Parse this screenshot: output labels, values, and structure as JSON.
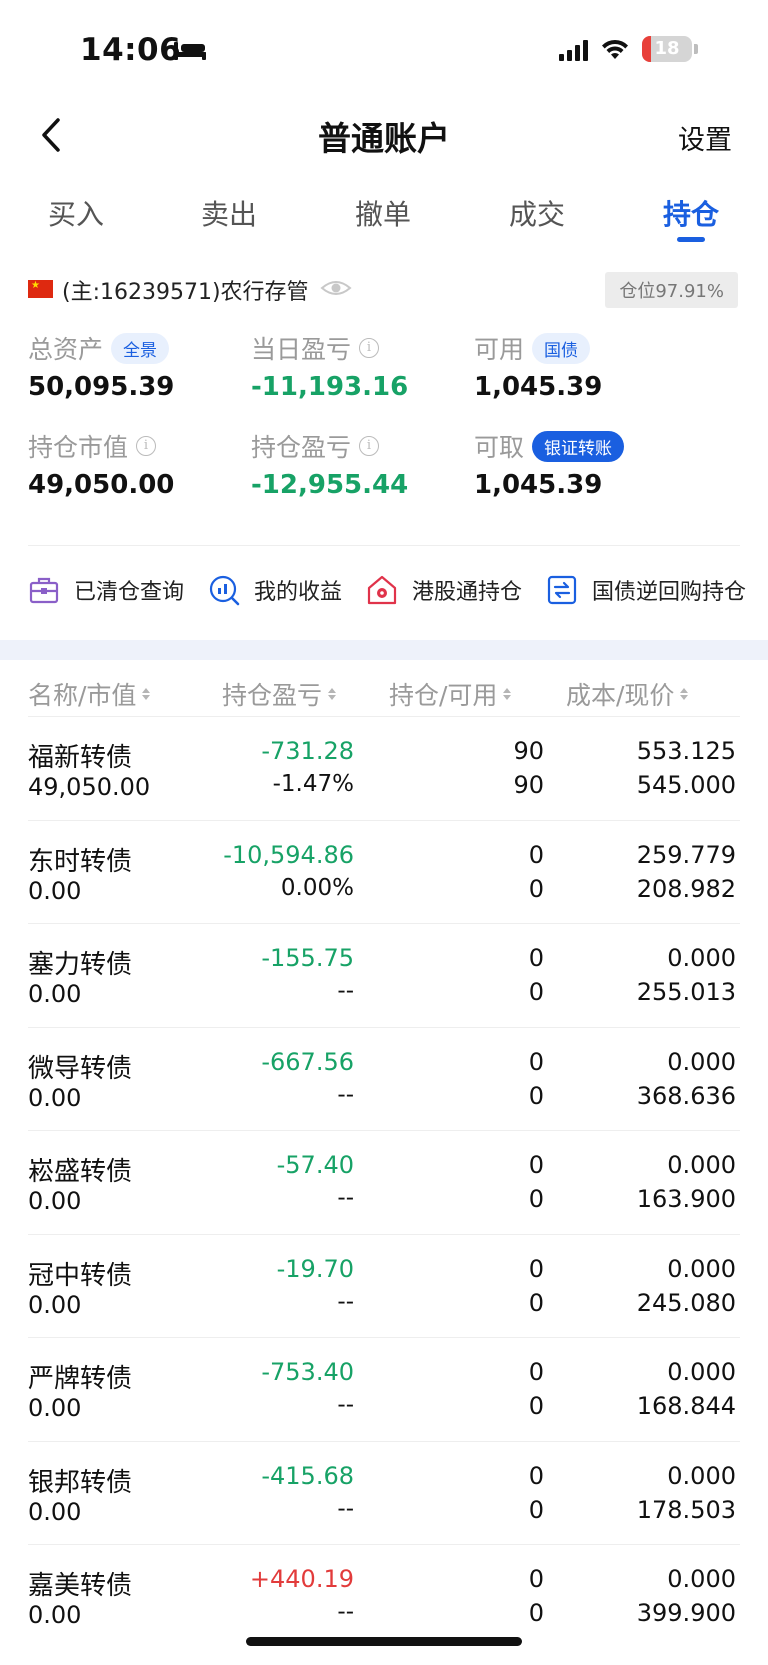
{
  "status_bar": {
    "time": "14:06",
    "battery": "18"
  },
  "nav": {
    "title": "普通账户",
    "settings_label": "设置"
  },
  "tabs": [
    {
      "label": "买入",
      "active": false
    },
    {
      "label": "卖出",
      "active": false
    },
    {
      "label": "撤单",
      "active": false
    },
    {
      "label": "成交",
      "active": false
    },
    {
      "label": "持仓",
      "active": true
    }
  ],
  "account": {
    "text": "(主:16239571)农行存管",
    "position_ratio": "仓位97.91%"
  },
  "summary": {
    "total_assets": {
      "label": "总资产",
      "badge": "全景",
      "value": "50,095.39"
    },
    "daily_pnl": {
      "label": "当日盈亏",
      "value": "-11,193.16"
    },
    "available": {
      "label": "可用",
      "badge": "国债",
      "value": "1,045.39"
    },
    "market_value": {
      "label": "持仓市值",
      "value": "49,050.00"
    },
    "position_pnl": {
      "label": "持仓盈亏",
      "value": "-12,955.44"
    },
    "withdrawable": {
      "label": "可取",
      "badge": "银证转账",
      "value": "1,045.39"
    }
  },
  "shortcuts": [
    {
      "label": "已清仓查询",
      "icon": "briefcase-icon"
    },
    {
      "label": "我的收益",
      "icon": "chart-magnifier-icon"
    },
    {
      "label": "港股通持仓",
      "icon": "hk-house-icon"
    },
    {
      "label": "国债逆回购持仓",
      "icon": "exchange-icon"
    }
  ],
  "table": {
    "headers": [
      "名称/市值",
      "持仓盈亏",
      "持仓/可用",
      "成本/现价"
    ],
    "rows": [
      {
        "name": "福新转债",
        "market_value": "49,050.00",
        "pnl": "-731.28",
        "pnl_pct": "-1.47%",
        "qty": "90",
        "avail": "90",
        "cost": "553.125",
        "price": "545.000",
        "pnl_color": "green"
      },
      {
        "name": "东时转债",
        "market_value": "0.00",
        "pnl": "-10,594.86",
        "pnl_pct": "0.00%",
        "qty": "0",
        "avail": "0",
        "cost": "259.779",
        "price": "208.982",
        "pnl_color": "green"
      },
      {
        "name": "塞力转债",
        "market_value": "0.00",
        "pnl": "-155.75",
        "pnl_pct": "--",
        "qty": "0",
        "avail": "0",
        "cost": "0.000",
        "price": "255.013",
        "pnl_color": "green"
      },
      {
        "name": "微导转债",
        "market_value": "0.00",
        "pnl": "-667.56",
        "pnl_pct": "--",
        "qty": "0",
        "avail": "0",
        "cost": "0.000",
        "price": "368.636",
        "pnl_color": "green"
      },
      {
        "name": "崧盛转债",
        "market_value": "0.00",
        "pnl": "-57.40",
        "pnl_pct": "--",
        "qty": "0",
        "avail": "0",
        "cost": "0.000",
        "price": "163.900",
        "pnl_color": "green"
      },
      {
        "name": "冠中转债",
        "market_value": "0.00",
        "pnl": "-19.70",
        "pnl_pct": "--",
        "qty": "0",
        "avail": "0",
        "cost": "0.000",
        "price": "245.080",
        "pnl_color": "green"
      },
      {
        "name": "严牌转债",
        "market_value": "0.00",
        "pnl": "-753.40",
        "pnl_pct": "--",
        "qty": "0",
        "avail": "0",
        "cost": "0.000",
        "price": "168.844",
        "pnl_color": "green"
      },
      {
        "name": "银邦转债",
        "market_value": "0.00",
        "pnl": "-415.68",
        "pnl_pct": "--",
        "qty": "0",
        "avail": "0",
        "cost": "0.000",
        "price": "178.503",
        "pnl_color": "green"
      },
      {
        "name": "嘉美转债",
        "market_value": "0.00",
        "pnl": "+440.19",
        "pnl_pct": "--",
        "qty": "0",
        "avail": "0",
        "cost": "0.000",
        "price": "399.900",
        "pnl_color": "red"
      }
    ]
  },
  "colors": {
    "accent": "#1a5fe0",
    "loss": "#17a266",
    "gain": "#e23b3b"
  }
}
